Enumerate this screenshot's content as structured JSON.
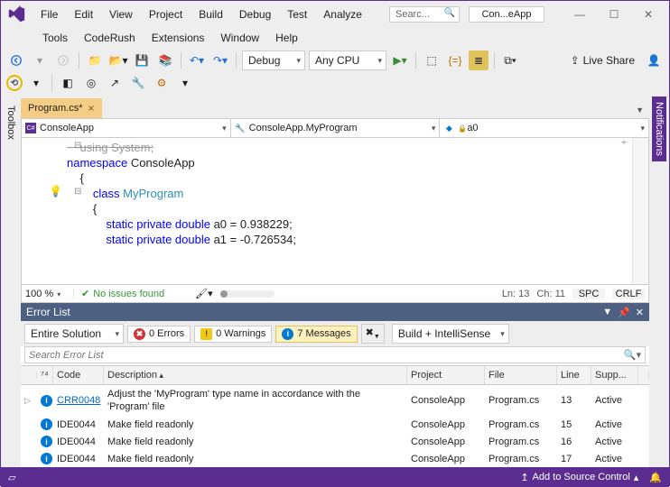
{
  "title": {
    "search_placeholder": "Searc...",
    "solution": "Con...eApp"
  },
  "menu": {
    "file": "File",
    "edit": "Edit",
    "view": "View",
    "project": "Project",
    "build": "Build",
    "debug": "Debug",
    "test": "Test",
    "analyze": "Analyze",
    "tools": "Tools",
    "coderush": "CodeRush",
    "extensions": "Extensions",
    "window": "Window",
    "help": "Help"
  },
  "toolbar": {
    "config": "Debug",
    "platform": "Any CPU",
    "live_share": "Live Share"
  },
  "side": {
    "toolbox": "Toolbox",
    "notifications": "Notifications"
  },
  "tab": {
    "name": "Program.cs*"
  },
  "nav": {
    "scope": "ConsoleApp",
    "class": "ConsoleApp.MyProgram",
    "member": "a0"
  },
  "code": {
    "l1": "    using System;",
    "l2": "",
    "l3": "   namespace ConsoleApp",
    "l4": "    {",
    "l5": "        class ",
    "l5b": "MyProgram",
    "l6": "        {",
    "l7": "            static private double a0 = 0.938229;",
    "l8": "            static private double a1 = -0.726534;"
  },
  "status": {
    "zoom": "100 %",
    "issues": "No issues found",
    "line": "Ln: 13",
    "col": "Ch: 11",
    "spc": "SPC",
    "crlf": "CRLF"
  },
  "errorlist": {
    "title": "Error List",
    "scope": "Entire Solution",
    "errors": "0 Errors",
    "warnings": "0 Warnings",
    "messages": "7 Messages",
    "source": "Build + IntelliSense",
    "search_placeholder": "Search Error List",
    "cols": {
      "code": "Code",
      "desc": "Description",
      "project": "Project",
      "file": "File",
      "line": "Line",
      "supp": "Supp..."
    },
    "rows": [
      {
        "code": "CRR0048",
        "desc": "Adjust the 'MyProgram' type name in accordance with the 'Program' file",
        "project": "ConsoleApp",
        "file": "Program.cs",
        "line": "13",
        "supp": "Active",
        "link": true,
        "expand": true
      },
      {
        "code": "IDE0044",
        "desc": "Make field readonly",
        "project": "ConsoleApp",
        "file": "Program.cs",
        "line": "15",
        "supp": "Active"
      },
      {
        "code": "IDE0044",
        "desc": "Make field readonly",
        "project": "ConsoleApp",
        "file": "Program.cs",
        "line": "16",
        "supp": "Active"
      },
      {
        "code": "IDE0044",
        "desc": "Make field readonly",
        "project": "ConsoleApp",
        "file": "Program.cs",
        "line": "17",
        "supp": "Active"
      }
    ]
  },
  "footer": {
    "source_control": "Add to Source Control"
  }
}
